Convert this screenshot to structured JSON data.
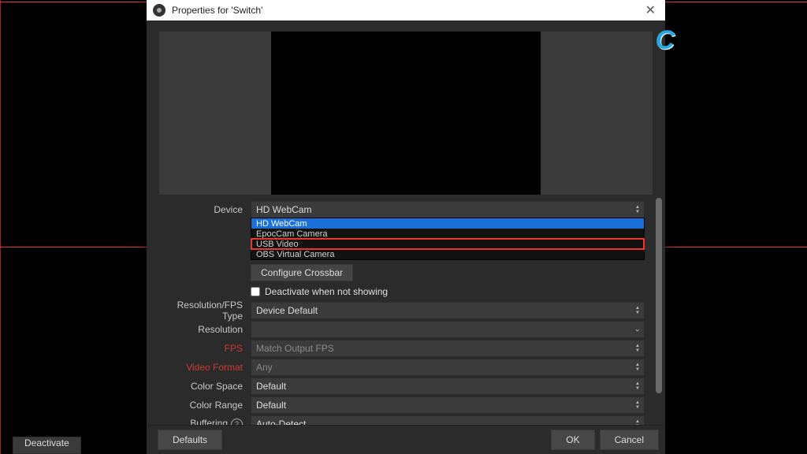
{
  "dialog": {
    "title": "Properties for 'Switch'"
  },
  "device": {
    "label": "Device",
    "selected": "HD WebCam",
    "options": [
      "HD WebCam",
      "EpocCam Camera",
      "USB Video",
      "OBS Virtual Camera"
    ],
    "highlight_index": 2
  },
  "configure_crossbar": "Configure Crossbar",
  "deactivate_checkbox": "Deactivate when not showing",
  "fields": {
    "res_fps_type": {
      "label": "Resolution/FPS Type",
      "value": "Device Default"
    },
    "resolution": {
      "label": "Resolution",
      "value": ""
    },
    "fps": {
      "label": "FPS",
      "value": "Match Output FPS"
    },
    "video_format": {
      "label": "Video Format",
      "value": "Any"
    },
    "color_space": {
      "label": "Color Space",
      "value": "Default"
    },
    "color_range": {
      "label": "Color Range",
      "value": "Default"
    },
    "buffering": {
      "label": "Buffering",
      "value": "Auto-Detect"
    }
  },
  "footer": {
    "defaults": "Defaults",
    "ok": "OK",
    "cancel": "Cancel"
  },
  "deactivate_button": "Deactivate",
  "watermark": "C"
}
